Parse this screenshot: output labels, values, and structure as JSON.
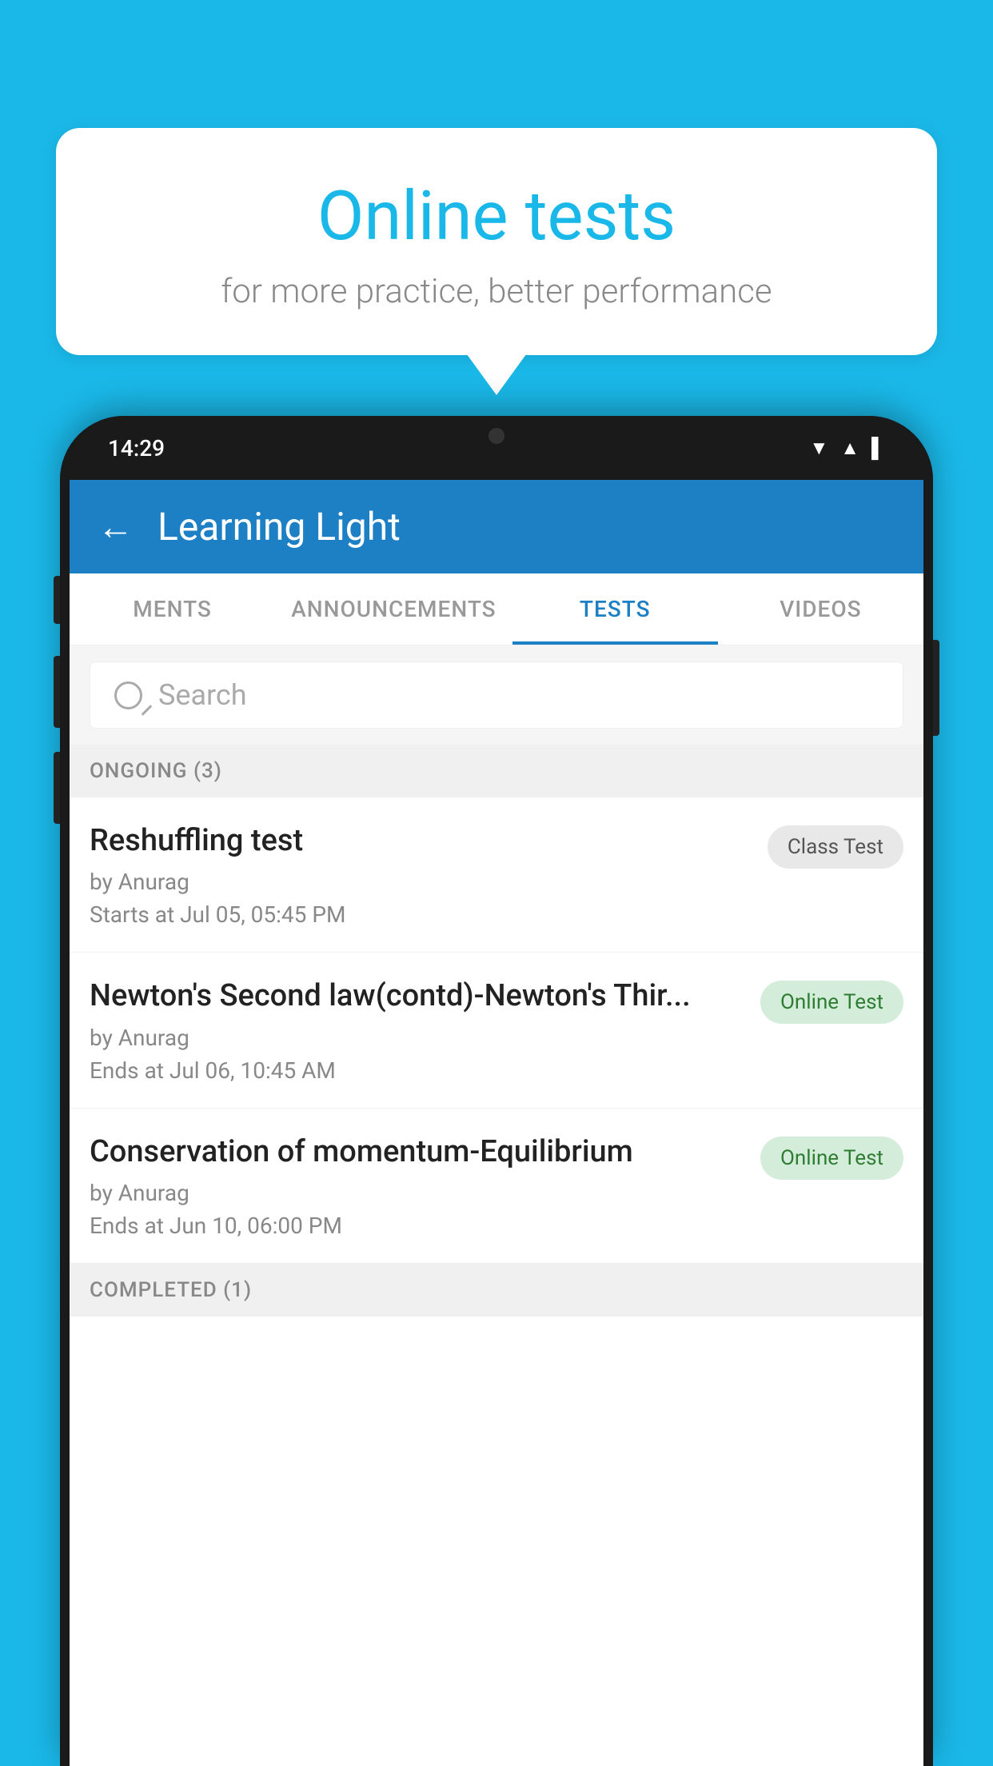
{
  "background_color": "#1ab8e8",
  "speech_bubble": {
    "title": "Online tests",
    "subtitle": "for more practice, better performance"
  },
  "phone": {
    "status_bar": {
      "time": "14:29"
    },
    "app_header": {
      "title": "Learning Light",
      "back_label": "←"
    },
    "tabs": [
      {
        "label": "MENTS",
        "active": false
      },
      {
        "label": "ANNOUNCEMENTS",
        "active": false
      },
      {
        "label": "TESTS",
        "active": true
      },
      {
        "label": "VIDEOS",
        "active": false
      }
    ],
    "search": {
      "placeholder": "Search"
    },
    "ongoing_section": {
      "header": "ONGOING (3)",
      "tests": [
        {
          "name": "Reshuffling test",
          "author": "by Anurag",
          "date": "Starts at  Jul 05, 05:45 PM",
          "badge": "Class Test",
          "badge_type": "class"
        },
        {
          "name": "Newton's Second law(contd)-Newton's Thir...",
          "author": "by Anurag",
          "date": "Ends at  Jul 06, 10:45 AM",
          "badge": "Online Test",
          "badge_type": "online"
        },
        {
          "name": "Conservation of momentum-Equilibrium",
          "author": "by Anurag",
          "date": "Ends at  Jun 10, 06:00 PM",
          "badge": "Online Test",
          "badge_type": "online"
        }
      ]
    },
    "completed_section": {
      "header": "COMPLETED (1)"
    }
  }
}
